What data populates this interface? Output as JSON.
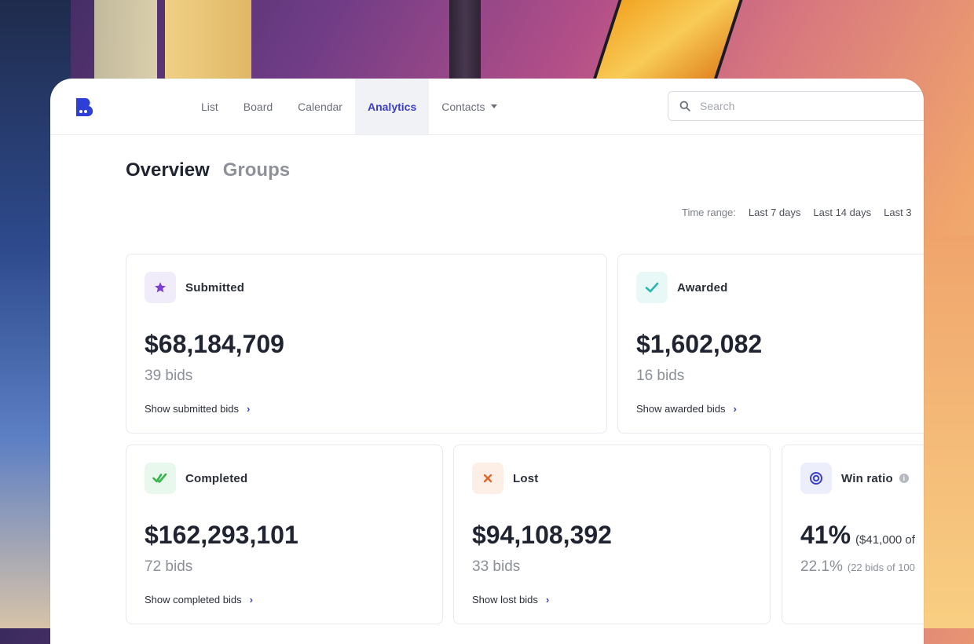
{
  "nav": {
    "items": [
      {
        "label": "List"
      },
      {
        "label": "Board"
      },
      {
        "label": "Calendar"
      },
      {
        "label": "Analytics"
      },
      {
        "label": "Contacts"
      }
    ],
    "active": "Analytics"
  },
  "search": {
    "placeholder": "Search"
  },
  "tabs": {
    "overview": "Overview",
    "groups": "Groups"
  },
  "time_range": {
    "label": "Time range:",
    "options": [
      "Last 7 days",
      "Last 14 days",
      "Last 3"
    ]
  },
  "cards": {
    "submitted": {
      "title": "Submitted",
      "value": "$68,184,709",
      "sub": "39 bids",
      "link": "Show submitted bids"
    },
    "awarded": {
      "title": "Awarded",
      "value": "$1,602,082",
      "sub": "16 bids",
      "link": "Show awarded bids"
    },
    "completed": {
      "title": "Completed",
      "value": "$162,293,101",
      "sub": "72 bids",
      "link": "Show completed bids"
    },
    "lost": {
      "title": "Lost",
      "value": "$94,108,392",
      "sub": "33 bids",
      "link": "Show lost bids"
    },
    "win_ratio": {
      "title": "Win ratio",
      "value": "41%",
      "value_note": "($41,000 of",
      "sub": "22.1%",
      "sub_note": "(22 bids of 100"
    }
  },
  "colors": {
    "accent": "#3b3fc6",
    "submitted_icon": "#7b3fd1",
    "awarded_icon": "#2ab6b0",
    "completed_icon": "#36b34a",
    "lost_icon": "#e0662a",
    "win_ratio_icon": "#3b3fc6"
  },
  "icons": {
    "submitted": "star-icon",
    "awarded": "check-icon",
    "completed": "double-check-icon",
    "lost": "x-icon",
    "win_ratio": "target-icon"
  }
}
